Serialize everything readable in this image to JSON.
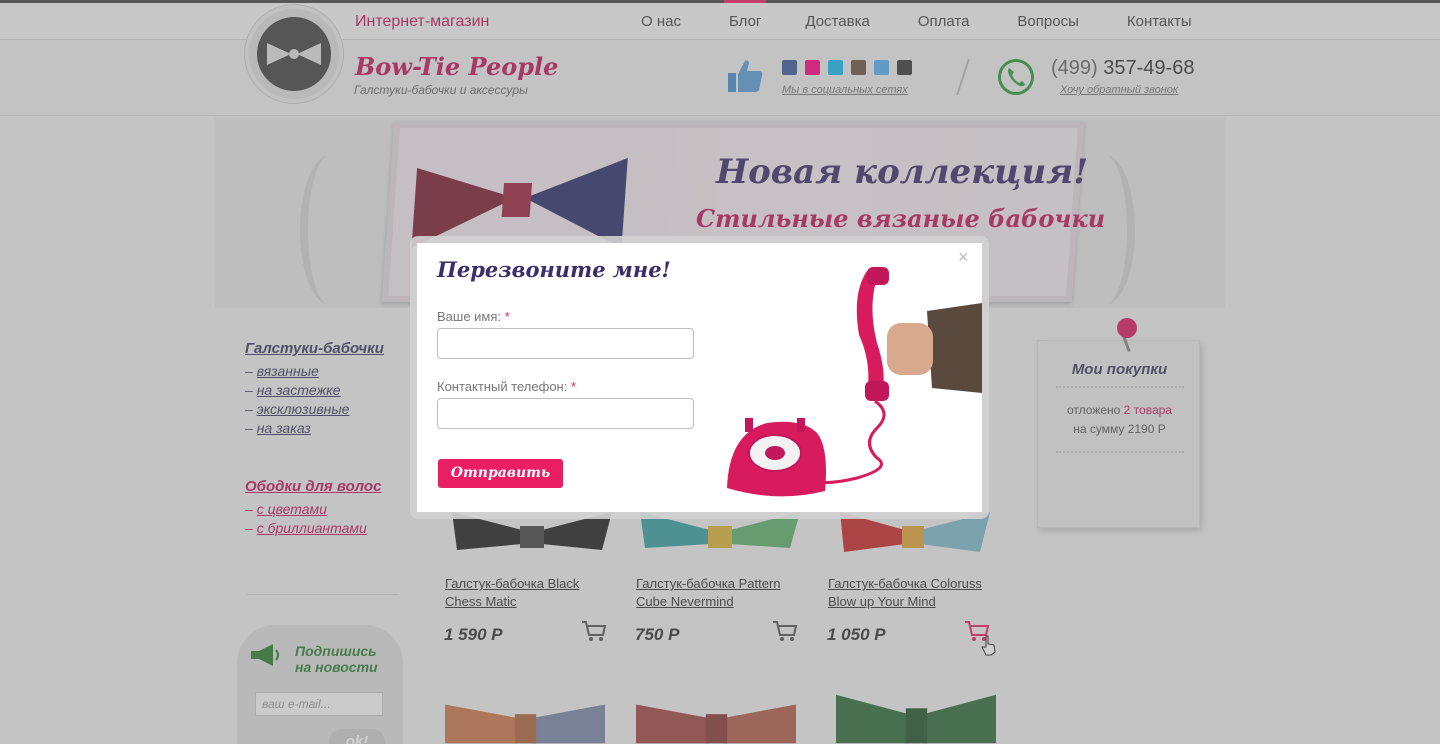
{
  "topbar": {
    "store_label": "Интернет-магазин",
    "nav": [
      "О нас",
      "Блог",
      "Доставка",
      "Оплата",
      "Вопросы",
      "Контакты"
    ],
    "active_nav": "Блог"
  },
  "header": {
    "brand": "Bow-Tie People",
    "tagline": "Галстуки-бабочки и аксессуры",
    "social_text": "Мы в социальных сетях",
    "phone_code": "(499)",
    "phone_number": "357-49-68",
    "callback_link": "Хочу обратный звонок",
    "social_icons": [
      "facebook-icon",
      "flickr-icon",
      "vimeo-icon",
      "instagram-icon",
      "twitter-icon",
      "googleplus-icon"
    ]
  },
  "banner": {
    "title": "Новая коллекция!",
    "subtitle": "Стильные вязаные бабочки"
  },
  "sidebar": {
    "cat1_title": "Галстуки-бабочки",
    "cat1_items": [
      "вязанные",
      "на застежке",
      "эксклюзивные",
      "на заказ"
    ],
    "cat2_title": "Ободки для волос",
    "cat2_items": [
      "с цветами",
      "с бриллиантами"
    ],
    "news_title_1": "Подпишись",
    "news_title_2": "на новости",
    "email_placeholder": "ваш e-mail...",
    "ok_label": "ok!"
  },
  "products": [
    {
      "name_1": "Галстук-бабочка Black ",
      "name_2": "Chess Matic",
      "price": "1 590 Р"
    },
    {
      "name_1": "Галстук-бабочка Pattern",
      "name_2": "Cube Nevermind",
      "price": "750 Р"
    },
    {
      "name_1": "Галстук-бабочка Coloruss",
      "name_2": "Blow up Your Mind",
      "price": "1 050 Р"
    }
  ],
  "cart": {
    "title": "Мои покупки",
    "line1_prefix": "отложено",
    "line1_count": "2 товара",
    "line2": "на сумму  2190 Р"
  },
  "modal": {
    "title": "Перезвоните мне!",
    "name_label": "Ваше имя:",
    "phone_label": "Контактный телефон:",
    "required_mark": "*",
    "submit_label": "Отправить",
    "close_label": "×"
  },
  "colors": {
    "accent": "#e91e63",
    "brand": "#c2185b",
    "dark_purple": "#3c2e6b",
    "green": "#2e7d32"
  }
}
